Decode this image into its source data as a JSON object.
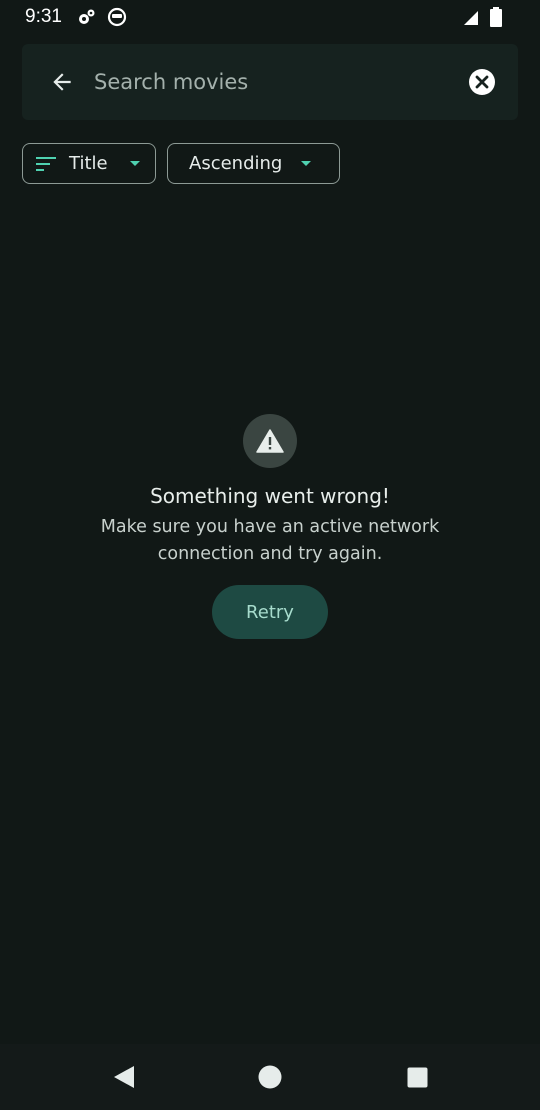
{
  "status_bar": {
    "time": "9:31",
    "icons": [
      "settings-icon",
      "vpn-face-icon",
      "signal-icon",
      "battery-icon"
    ]
  },
  "search": {
    "placeholder": "Search movies",
    "value": "",
    "back_icon": "arrow-back-icon",
    "clear_icon": "close-circle-icon"
  },
  "filters": {
    "sort_field": {
      "label": "Title",
      "icon": "sort-icon"
    },
    "sort_order": {
      "label": "Ascending"
    }
  },
  "error": {
    "icon": "warning-icon",
    "title": "Something went wrong!",
    "message": "Make sure you have an active network connection and try again.",
    "retry_label": "Retry"
  },
  "navigation": {
    "buttons": [
      "back-triangle-icon",
      "home-circle-icon",
      "recents-square-icon"
    ]
  },
  "colors": {
    "background": "#111816",
    "accent": "#4fd1b0",
    "retry_button": "#1e4a43"
  }
}
